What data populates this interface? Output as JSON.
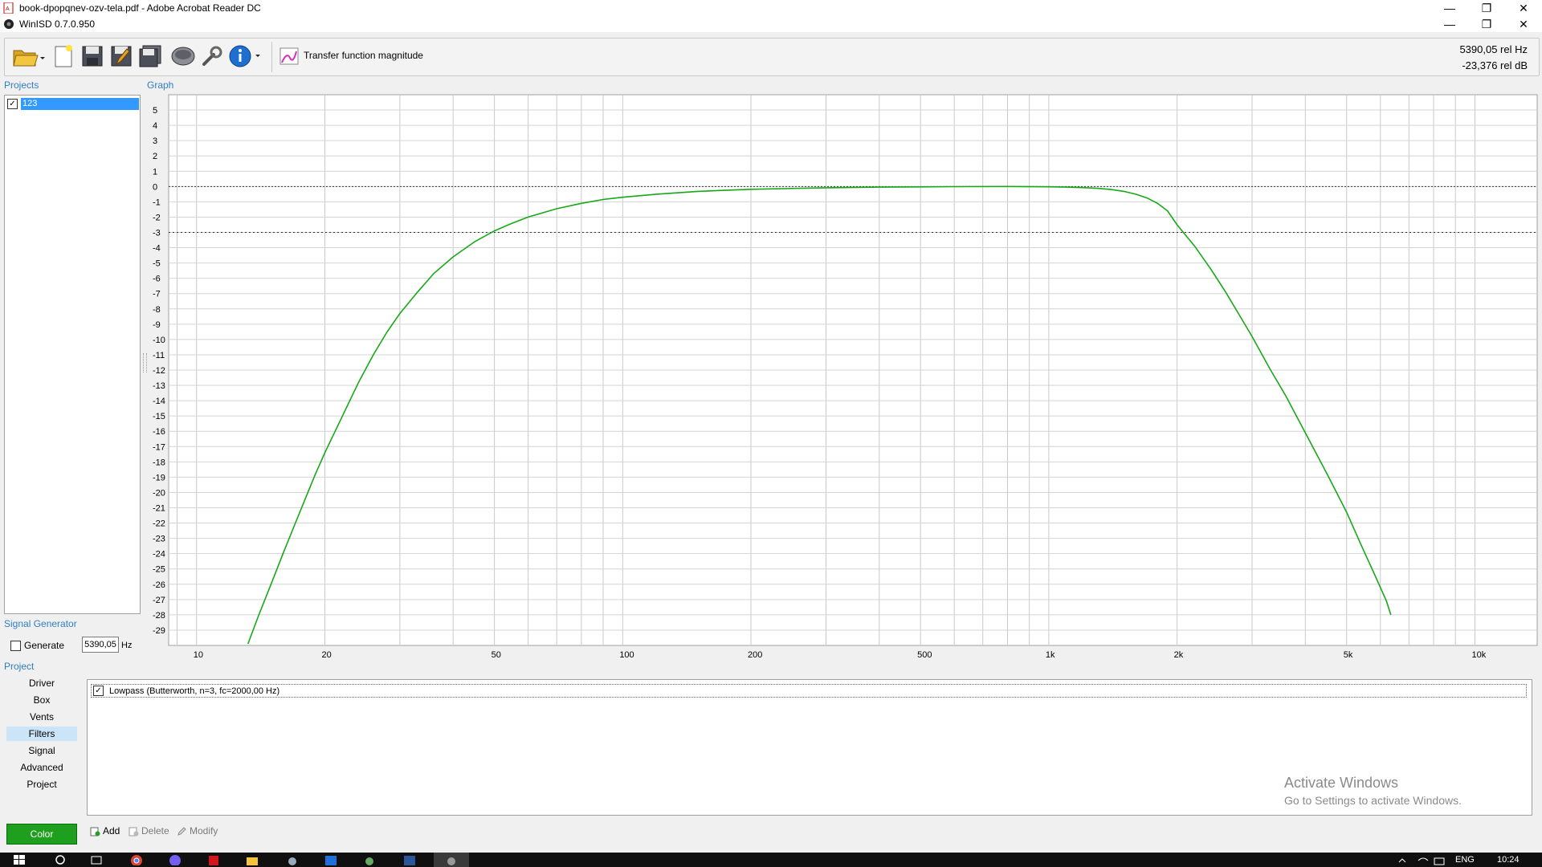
{
  "outer_window": {
    "title": "book-dpopqnev-ozv-tela.pdf - Adobe Acrobat Reader DC",
    "min": "—",
    "restore": "❐",
    "close": "✕"
  },
  "app_window": {
    "title": "WinISD 0.7.0.950",
    "min": "—",
    "restore": "❐",
    "close": "✕"
  },
  "toolbar": {
    "graph_type_label": "Transfer function magnitude",
    "readout_freq": "5390,05 rel Hz",
    "readout_db": "-23,376 rel dB"
  },
  "projects": {
    "label": "Projects",
    "items": [
      {
        "name": "123",
        "checked": true
      }
    ]
  },
  "graph": {
    "label": "Graph"
  },
  "signal_generator": {
    "label": "Signal Generator",
    "generate_label": "Generate",
    "frequency": "5390,05",
    "unit": "Hz"
  },
  "project_nav": {
    "label": "Project",
    "items": [
      "Driver",
      "Box",
      "Vents",
      "Filters",
      "Signal",
      "Advanced",
      "Project"
    ],
    "selected": "Filters"
  },
  "filters": {
    "items": [
      {
        "label": "Lowpass (Butterworth, n=3, fc=2000,00 Hz)",
        "checked": true
      }
    ],
    "add_label": "Add",
    "delete_label": "Delete",
    "modify_label": "Modify",
    "color_label": "Color"
  },
  "watermark": {
    "line1": "Activate Windows",
    "line2": "Go to Settings to activate Windows."
  },
  "taskbar": {
    "language": "ENG",
    "time": "10:24"
  },
  "colors": {
    "curve": "#17a817",
    "accent": "#2f7fc4",
    "selection": "#3399ff",
    "color_button": "#1ea01e"
  },
  "chart_data": {
    "type": "line",
    "xscale": "log",
    "xlim": [
      8.6,
      14000
    ],
    "ylim": [
      -30,
      6
    ],
    "x_ticks": [
      10,
      20,
      50,
      100,
      200,
      500,
      1000,
      2000,
      5000,
      10000
    ],
    "x_tick_labels": [
      "10",
      "20",
      "50",
      "100",
      "200",
      "500",
      "1k",
      "2k",
      "5k",
      "10k"
    ],
    "y_ticks": [
      5,
      4,
      3,
      2,
      1,
      0,
      -1,
      -2,
      -3,
      -4,
      -5,
      -6,
      -7,
      -8,
      -9,
      -10,
      -11,
      -12,
      -13,
      -14,
      -15,
      -16,
      -17,
      -18,
      -19,
      -20,
      -21,
      -22,
      -23,
      -24,
      -25,
      -26,
      -27,
      -28,
      -29
    ],
    "ref_lines": [
      0,
      -3
    ],
    "grid": true,
    "series": [
      {
        "color": "#17a817",
        "x": [
          13.2,
          14,
          15,
          16,
          17,
          18,
          19,
          20,
          22,
          24,
          26,
          28,
          30,
          33,
          36,
          40,
          45,
          50,
          55,
          60,
          70,
          80,
          90,
          100,
          120,
          150,
          200,
          300,
          400,
          600,
          800,
          1000,
          1100,
          1200,
          1300,
          1400,
          1500,
          1600,
          1700,
          1800,
          1900,
          2000,
          2200,
          2400,
          2600,
          2800,
          3000,
          3300,
          3600,
          4000,
          4500,
          5000,
          5400,
          5800,
          6200,
          6350
        ],
        "y": [
          -29.9,
          -28.0,
          -25.9,
          -23.9,
          -22.1,
          -20.4,
          -18.8,
          -17.4,
          -15.0,
          -12.8,
          -11.0,
          -9.5,
          -8.3,
          -6.9,
          -5.7,
          -4.6,
          -3.6,
          -2.9,
          -2.4,
          -2.0,
          -1.45,
          -1.1,
          -0.85,
          -0.7,
          -0.5,
          -0.32,
          -0.18,
          -0.08,
          -0.04,
          -0.01,
          0,
          -0.02,
          -0.04,
          -0.07,
          -0.12,
          -0.2,
          -0.32,
          -0.5,
          -0.75,
          -1.1,
          -1.6,
          -2.5,
          -3.9,
          -5.4,
          -6.9,
          -8.4,
          -9.8,
          -11.9,
          -13.7,
          -16.1,
          -18.8,
          -21.3,
          -23.4,
          -25.3,
          -27.1,
          -28.0
        ]
      }
    ]
  }
}
